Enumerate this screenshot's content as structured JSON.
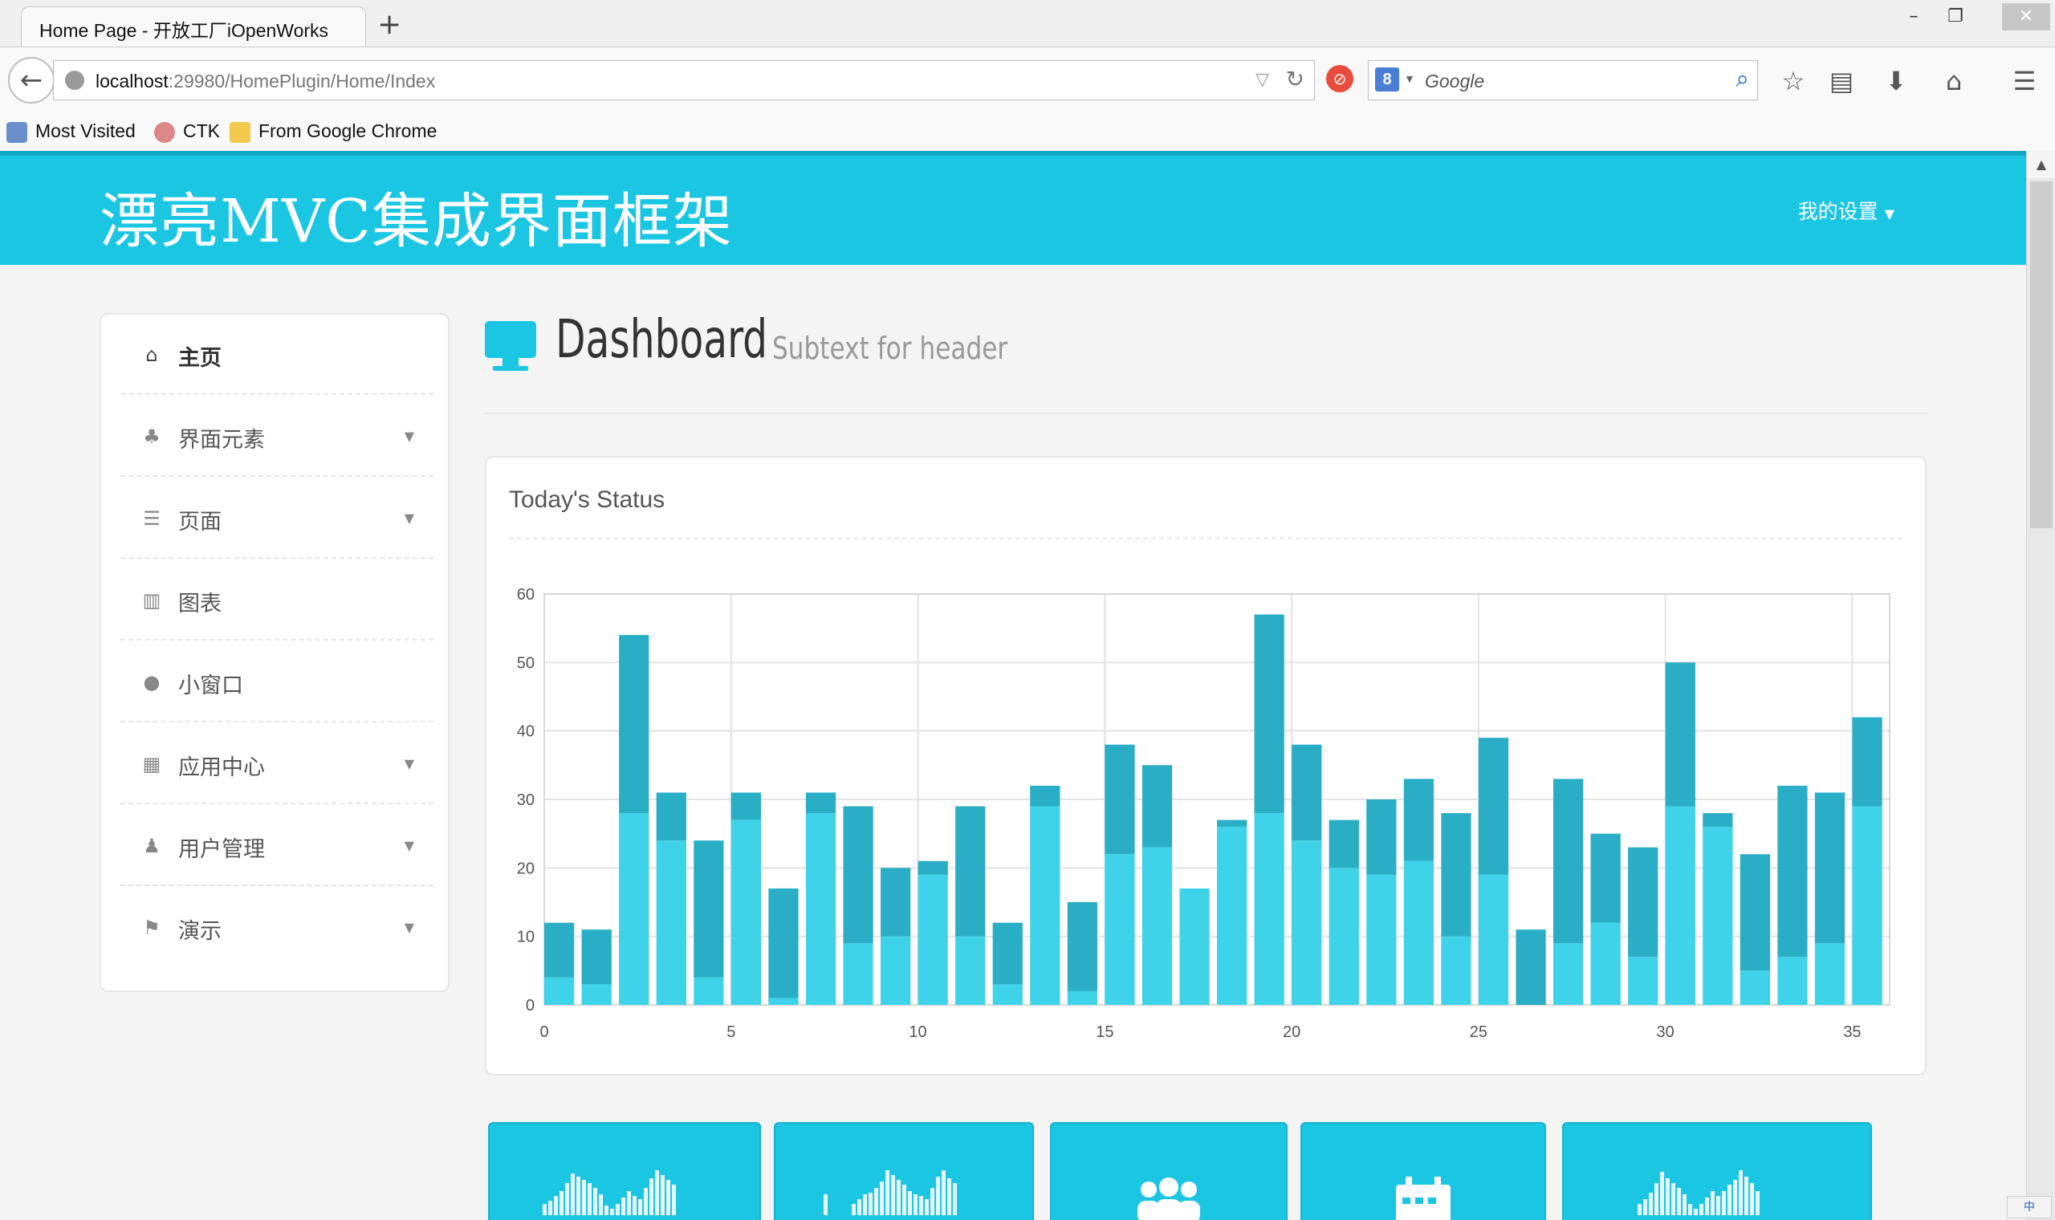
{
  "browser": {
    "tab_title": "Home Page - 开放工厂iOpenWorks",
    "new_tab": "+",
    "window_controls": {
      "minimize": "–",
      "restore": "❐",
      "close": "✕"
    },
    "url_host": "localhost",
    "url_rest": ":29980/HomePlugin/Home/Index",
    "search_engine_letter": "8",
    "search_placeholder": "Google",
    "toolbar_icons": [
      "bookmark-star-icon",
      "reading-list-icon",
      "download-icon",
      "home-icon",
      "menu-icon"
    ],
    "bookmarks": [
      {
        "label": "Most Visited",
        "icon": "most-visited-icon"
      },
      {
        "label": "CTK",
        "icon": "ctk-icon"
      },
      {
        "label": "From Google Chrome",
        "icon": "folder-icon"
      }
    ]
  },
  "header": {
    "brand": "漂亮MVC集成界面框架",
    "user_menu": "我的设置"
  },
  "sidebar": {
    "items": [
      {
        "label": "主页",
        "icon": "home-icon",
        "caret": false,
        "active": true
      },
      {
        "label": "界面元素",
        "icon": "sitemap-icon",
        "caret": true
      },
      {
        "label": "页面",
        "icon": "list-icon",
        "caret": true
      },
      {
        "label": "图表",
        "icon": "bar-chart-icon",
        "caret": false
      },
      {
        "label": "小窗口",
        "icon": "comment-icon",
        "caret": false
      },
      {
        "label": "应用中心",
        "icon": "grid-icon",
        "caret": true
      },
      {
        "label": "用户管理",
        "icon": "user-icon",
        "caret": true
      },
      {
        "label": "演示",
        "icon": "flag-icon",
        "caret": true
      }
    ]
  },
  "page_header": {
    "title": "Dashboard",
    "subtitle": "Subtext for header"
  },
  "status_panel": {
    "title": "Today's Status"
  },
  "colors": {
    "accent": "#1bc6e3",
    "bar_top": "#2aaec5",
    "bar_bottom": "#3fd3ea"
  },
  "chart_data": {
    "type": "bar",
    "stacked": true,
    "x": [
      0,
      1,
      2,
      3,
      4,
      5,
      6,
      7,
      8,
      9,
      10,
      11,
      12,
      13,
      14,
      15,
      16,
      17,
      18,
      19,
      20,
      21,
      22,
      23,
      24,
      25,
      26,
      27,
      28,
      29,
      30,
      31,
      32,
      33,
      34,
      35
    ],
    "x_ticks": [
      0,
      5,
      10,
      15,
      20,
      25,
      30,
      35
    ],
    "y_ticks": [
      0,
      10,
      20,
      30,
      40,
      50,
      60
    ],
    "ylim": [
      0,
      60
    ],
    "xlim": [
      0,
      36
    ],
    "grid": true,
    "series": [
      {
        "values": [
          4,
          3,
          28,
          24,
          4,
          27,
          1,
          28,
          9,
          10,
          19,
          10,
          3,
          29,
          2,
          22,
          23,
          17,
          26,
          28,
          24,
          20,
          19,
          21,
          10,
          19,
          0,
          9,
          12,
          7,
          29,
          26,
          5,
          7,
          9,
          29
        ]
      },
      {
        "values": [
          8,
          8,
          26,
          7,
          20,
          4,
          16,
          3,
          20,
          10,
          2,
          19,
          9,
          3,
          13,
          16,
          12,
          0,
          1,
          29,
          14,
          7,
          11,
          12,
          18,
          20,
          11,
          24,
          13,
          16,
          21,
          2,
          17,
          25,
          22,
          13
        ]
      }
    ]
  },
  "tiles": [
    {
      "icon": "sparkline-icon"
    },
    {
      "icon": "sparkline-icon"
    },
    {
      "icon": "users-icon"
    },
    {
      "icon": "calendar-icon"
    },
    {
      "icon": "sparkline-icon"
    }
  ],
  "ime_indicator": "中"
}
